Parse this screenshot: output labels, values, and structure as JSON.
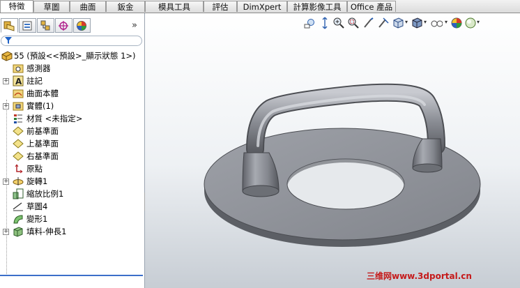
{
  "command_tabs": [
    "特徵",
    "草圖",
    "曲面",
    "鈑金",
    "模具工具",
    "評估",
    "DimXpert",
    "計算影像工具",
    "Office 產品"
  ],
  "active_tab": 0,
  "panel_tabs": [
    "feature-manager",
    "property-manager",
    "configuration-manager",
    "dimxpert-manager",
    "display-manager"
  ],
  "tree": {
    "root": "55  (預設<<預設>_顯示狀態 1>)",
    "items": [
      {
        "label": "感測器",
        "icon": "sensor-folder",
        "expand": false
      },
      {
        "label": "註記",
        "icon": "annotation",
        "expand": true
      },
      {
        "label": "曲面本體",
        "icon": "surface-bodies-folder",
        "expand": false
      },
      {
        "label": "實體(1)",
        "icon": "solid-bodies-folder",
        "expand": true
      },
      {
        "label": "材質 <未指定>",
        "icon": "material",
        "expand": false
      },
      {
        "label": "前基準面",
        "icon": "plane",
        "expand": false
      },
      {
        "label": "上基準面",
        "icon": "plane",
        "expand": false
      },
      {
        "label": "右基準面",
        "icon": "plane",
        "expand": false
      },
      {
        "label": "原點",
        "icon": "origin",
        "expand": false
      },
      {
        "label": "旋轉1",
        "icon": "revolve",
        "expand": true
      },
      {
        "label": "縮放比例1",
        "icon": "scale",
        "expand": false
      },
      {
        "label": "草圖4",
        "icon": "sketch",
        "expand": false
      },
      {
        "label": "變形1",
        "icon": "flex",
        "expand": false
      },
      {
        "label": "填料-伸長1",
        "icon": "extrude",
        "expand": true
      }
    ]
  },
  "view_toolbar": [
    "zoom-to-fit",
    "zoom-area",
    "zoom-in-out",
    "zoom-to-selection",
    "rotate",
    "section-view",
    "view-orientation",
    "display-style",
    "hide-show-items",
    "edit-appearance",
    "apply-scene"
  ],
  "watermark": "三维网www.3dportal.cn",
  "colors": {
    "part": "#8e9299",
    "tree_highlight": "#3c6fc9",
    "watermark": "#c51a1a"
  }
}
